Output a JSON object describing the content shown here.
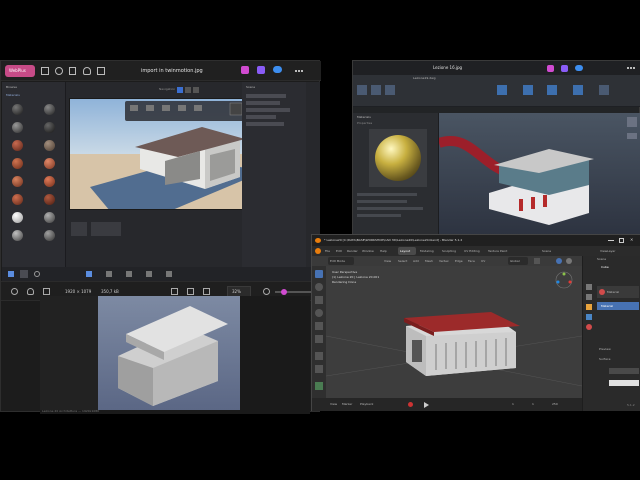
{
  "photos": {
    "app_badge": "WebPlus",
    "file_title": "import in twinmotion.jpg",
    "subtitle": "Twinmotion 2025.1 · Riflessione2",
    "status_dims": "1920 × 1079",
    "status_size": "350,7 kB",
    "zoom": "32%"
  },
  "twinmotion": {
    "library_header": "Browse",
    "library_category": "Materials",
    "outliner_title": "Scene",
    "toolbar_label": "Navigation"
  },
  "cad": {
    "title": "Lezione 16.jpg",
    "inner_title": "Lezione19.dwg",
    "panel_title": "Materials",
    "panel_sub": "Properties",
    "status": "Layout1"
  },
  "blender": {
    "title": "* Lezione20 [C:\\DATA\\BASE\\WORKSHOP\\CAD 3D\\Lezione20\\Lezione20.blend] - Blender 5.1.2",
    "menu": [
      "File",
      "Edit",
      "Render",
      "Window",
      "Help"
    ],
    "workspaces": [
      "Layout",
      "Modeling",
      "Sculpting",
      "UV Editing",
      "Texture Paint"
    ],
    "header": [
      "Edit Mode",
      "View",
      "Select",
      "Add",
      "Mesh",
      "Vertex",
      "Edge",
      "Face",
      "UV"
    ],
    "transform": "Global",
    "overlay_line1": "User Perspective",
    "overlay_line2": "(1) Lezione 20 | Lezione 20.001",
    "overlay_line3": "Rendering Done",
    "scene_label": "Scene",
    "view_layer": "ViewLayer",
    "props_object": "Cube",
    "props_material": "Material",
    "props_surface": "Surface",
    "props_preview": "Preview",
    "timeline": [
      "Playback",
      "View",
      "Marker"
    ],
    "frame": "1",
    "start": "1",
    "end": "250",
    "version": "5.1.2"
  },
  "viewer": {
    "footer": "Lezione 20 Architettura — 1920x1080"
  },
  "colors": {
    "blender_accent": "#4772b3",
    "photos_badge": "#c74b87",
    "roof_red": "#9c2a2a"
  }
}
